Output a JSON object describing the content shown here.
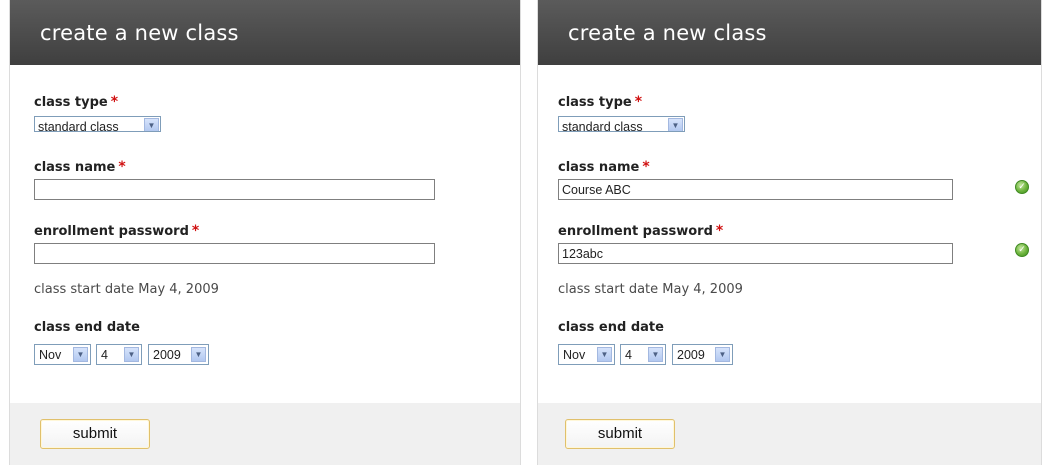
{
  "left": {
    "title": "create a new class",
    "class_type": {
      "label": "class type",
      "required_mark": "*",
      "value": "standard class",
      "arrow_icon": "chevron-down-icon"
    },
    "class_name": {
      "label": "class name",
      "required_mark": "*",
      "value": ""
    },
    "enrollment_password": {
      "label": "enrollment password",
      "required_mark": "*",
      "value": ""
    },
    "start_date_text": "class start date May 4, 2009",
    "end_date": {
      "label": "class end date",
      "month": "Nov",
      "day": "4",
      "year": "2009"
    },
    "submit_label": "submit"
  },
  "right": {
    "title": "create a new class",
    "class_type": {
      "label": "class type",
      "required_mark": "*",
      "value": "standard class",
      "arrow_icon": "chevron-down-icon"
    },
    "class_name": {
      "label": "class name",
      "required_mark": "*",
      "value": "Course ABC",
      "valid_icon": "check-circle-icon"
    },
    "enrollment_password": {
      "label": "enrollment password",
      "required_mark": "*",
      "value": "123abc",
      "valid_icon": "check-circle-icon"
    },
    "start_date_text": "class start date May 4, 2009",
    "end_date": {
      "label": "class end date",
      "month": "Nov",
      "day": "4",
      "year": "2009"
    },
    "submit_label": "submit"
  },
  "colors": {
    "header_bg": "#4a4a4a",
    "required": "#d01010",
    "valid": "#6cb33c",
    "footer_bg": "#f0f0f0",
    "submit_border": "#e0c06c"
  }
}
